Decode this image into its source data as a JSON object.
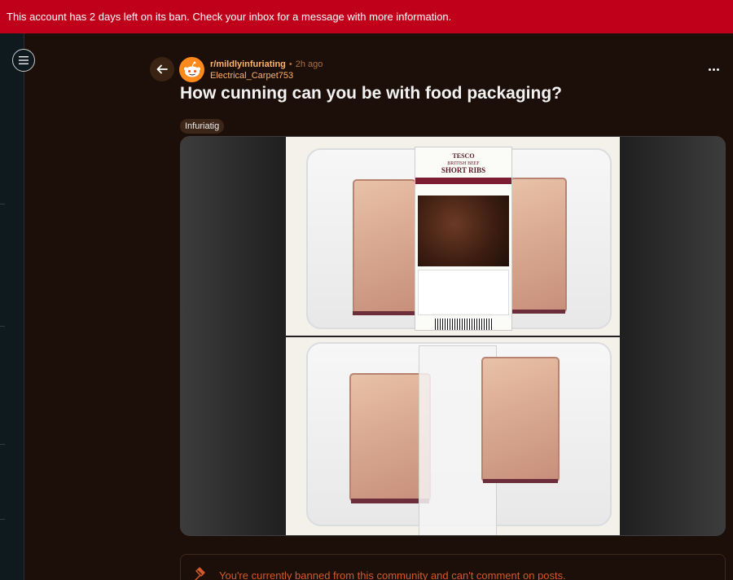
{
  "banner": {
    "text": "This account has 2 days left on its ban. Check your inbox for a message with more information."
  },
  "post": {
    "subreddit": "r/mildlyinfuriating",
    "separator": "•",
    "time_ago": "2h ago",
    "author": "Electrical_Carpet753",
    "title": "How cunning can you be with food packaging?",
    "flair": "Infuriatig"
  },
  "package_label": {
    "brand": "TESCO",
    "line1": "BRITISH BEEF",
    "line2": "SHORT RIBS"
  },
  "comment_box": {
    "ban_message": "You're currently banned from this community and can't comment on posts."
  },
  "colors": {
    "banner_bg": "#c0001a",
    "accent": "#ffb36b",
    "page_bg": "#1c0e08"
  },
  "icons": {
    "menu": "hamburger-icon",
    "back": "arrow-left-icon",
    "more": "more-horizontal-icon",
    "ban": "gavel-icon"
  }
}
